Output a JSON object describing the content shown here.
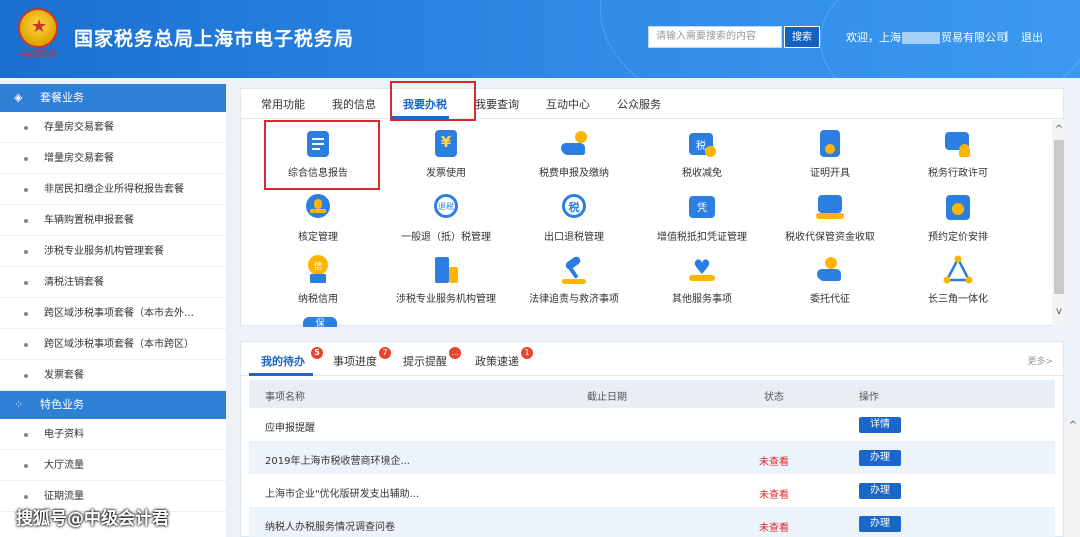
{
  "header": {
    "title": "国家税务总局上海市电子税务局",
    "emblem_text": "中国税务",
    "search_placeholder": "请输入需要搜索的内容",
    "search_button": "搜索",
    "welcome_prefix": "欢迎，上海",
    "welcome_suffix": "贸易有限公司",
    "separator": "|",
    "logout": "退出"
  },
  "sidebar": {
    "group1": "套餐业务",
    "group1_items": [
      "存量房交易套餐",
      "增量房交易套餐",
      "非居民扣缴企业所得税报告套餐",
      "车辆购置税申报套餐",
      "涉税专业服务机构管理套餐",
      "清税注销套餐",
      "跨区域涉税事项套餐（本市去外…",
      "跨区域涉税事项套餐（本市跨区）",
      "发票套餐"
    ],
    "group2": "特色业务",
    "group2_items": [
      "电子资料",
      "大厅流量",
      "征期流量"
    ]
  },
  "tabs": [
    "常用功能",
    "我的信息",
    "我要办税",
    "我要查询",
    "互动中心",
    "公众服务"
  ],
  "tiles": [
    "综合信息报告",
    "发票使用",
    "税费申报及缴纳",
    "税收减免",
    "证明开具",
    "税务行政许可",
    "核定管理",
    "一般退（抵）税管理",
    "出口退税管理",
    "增值税抵扣凭证管理",
    "税收代保管资金收取",
    "预约定价安排",
    "纳税信用",
    "涉税专业服务机构管理",
    "法律追责与救济事项",
    "其他服务事项",
    "委托代征",
    "长三角一体化"
  ],
  "tile_icon_text": {
    "refund": "退税",
    "export": "税",
    "vat": "凭",
    "credit": "信",
    "reduce": "税",
    "partial": "保"
  },
  "bottom_tabs": [
    {
      "label": "我的待办",
      "badge": "5"
    },
    {
      "label": "事项进度",
      "badge": "7"
    },
    {
      "label": "提示提醒",
      "badge": "..."
    },
    {
      "label": "政策速递",
      "badge": "1"
    }
  ],
  "more": "更多>",
  "table": {
    "headers": [
      "事项名称",
      "截止日期",
      "状态",
      "操作"
    ],
    "rows": [
      {
        "name": "应申报提醒",
        "status": "",
        "action": "详情"
      },
      {
        "name": "2019年上海市税收营商环境企...",
        "status": "未查看",
        "action": "办理"
      },
      {
        "name": "上海市企业\"优化版研发支出辅助...",
        "status": "未查看",
        "action": "办理"
      },
      {
        "name": "纳税人办税服务情况调查问卷",
        "status": "未查看",
        "action": "办理"
      }
    ]
  },
  "watermark": "搜狐号@中级会计君",
  "colors": {
    "accent": "#1a66c9",
    "highlight": "#e0262b",
    "header": "#2f8be6"
  }
}
